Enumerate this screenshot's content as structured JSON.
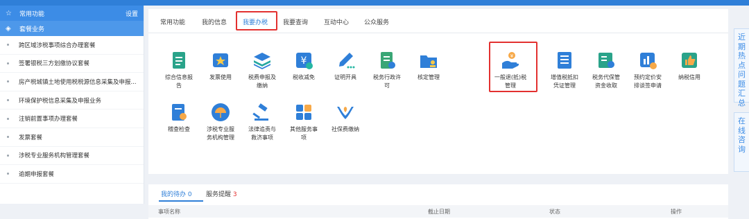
{
  "sidebar": {
    "common": {
      "label": "常用功能",
      "settings": "设置"
    },
    "package": {
      "label": "套餐业务"
    },
    "items": [
      {
        "label": "跨区域涉税事项综合办理套餐"
      },
      {
        "label": "签署银税三方划缴协议套餐"
      },
      {
        "label": "房产税城镇土地使用税税源信息采集及申报..."
      },
      {
        "label": "环境保护税信息采集及申报业务"
      },
      {
        "label": "注销前置事项办理套餐"
      },
      {
        "label": "发票套餐"
      },
      {
        "label": "涉税专业服务机构管理套餐"
      },
      {
        "label": "逾期申报套餐"
      }
    ]
  },
  "tabs": [
    {
      "label": "常用功能"
    },
    {
      "label": "我的信息"
    },
    {
      "label": "我要办税"
    },
    {
      "label": "我要查询"
    },
    {
      "label": "互动中心"
    },
    {
      "label": "公众服务"
    }
  ],
  "services_row1": [
    {
      "l1": "综合信息报",
      "l2": "告",
      "icon": "doc-report-icon",
      "color": "#2aa38a"
    },
    {
      "l1": "发票使用",
      "l2": "",
      "icon": "invoice-icon",
      "color": "#2f7fd8"
    },
    {
      "l1": "税费申报及",
      "l2": "缴纳",
      "icon": "layers-icon",
      "color": "#25a8a0"
    },
    {
      "l1": "税收减免",
      "l2": "",
      "icon": "yuan-icon",
      "color": "#2f7fd8"
    },
    {
      "l1": "证明开具",
      "l2": "",
      "icon": "pen-icon",
      "color": "#26b7a3"
    },
    {
      "l1": "税务行政许",
      "l2": "可",
      "icon": "permit-icon",
      "color": "#3aa676"
    },
    {
      "l1": "核定管理",
      "l2": "",
      "icon": "folder-user-icon",
      "color": "#2f7fd8"
    },
    {
      "l1": "一般退(抵)税",
      "l2": "管理",
      "icon": "refund-hand-icon",
      "color": "#2f7fd8"
    },
    {
      "l1": "增值税抵扣",
      "l2": "凭证管理",
      "icon": "ledger-icon",
      "color": "#2f7fd8"
    },
    {
      "l1": "税务代保管",
      "l2": "资金收取",
      "icon": "safe-icon",
      "color": "#2aa38a"
    },
    {
      "l1": "预约定价安",
      "l2": "排谈签申请",
      "icon": "chart-coin-icon",
      "color": "#2f7fd8"
    },
    {
      "l1": "纳税信用",
      "l2": "",
      "icon": "thumb-icon",
      "color": "#2aa38a"
    }
  ],
  "services_row2": [
    {
      "l1": "稽查检查",
      "l2": "",
      "icon": "inspect-icon",
      "color": "#2f7fd8"
    },
    {
      "l1": "涉税专业服",
      "l2": "务机构管理",
      "icon": "umbrella-icon",
      "color": "#2f7fd8"
    },
    {
      "l1": "法律追责与",
      "l2": "救济事项",
      "icon": "gavel-icon",
      "color": "#2f7fd8"
    },
    {
      "l1": "其他服务事",
      "l2": "项",
      "icon": "grid-icon",
      "color": "#2f7fd8"
    },
    {
      "l1": "社保费缴纳",
      "l2": "",
      "icon": "social-hands-icon",
      "color": "#2f7fd8"
    }
  ],
  "lower": {
    "todo_label": "我的待办",
    "todo_count": "0",
    "remind_label": "服务提醒",
    "remind_count": "3",
    "col_name": "事项名称",
    "col_deadline": "截止日期",
    "col_status": "状态",
    "col_action": "操作"
  },
  "float1": "近期热点问题汇总",
  "float2": "在线咨询",
  "colors": {
    "accent": "#2f7fd8",
    "highlight": "#e3302f"
  }
}
